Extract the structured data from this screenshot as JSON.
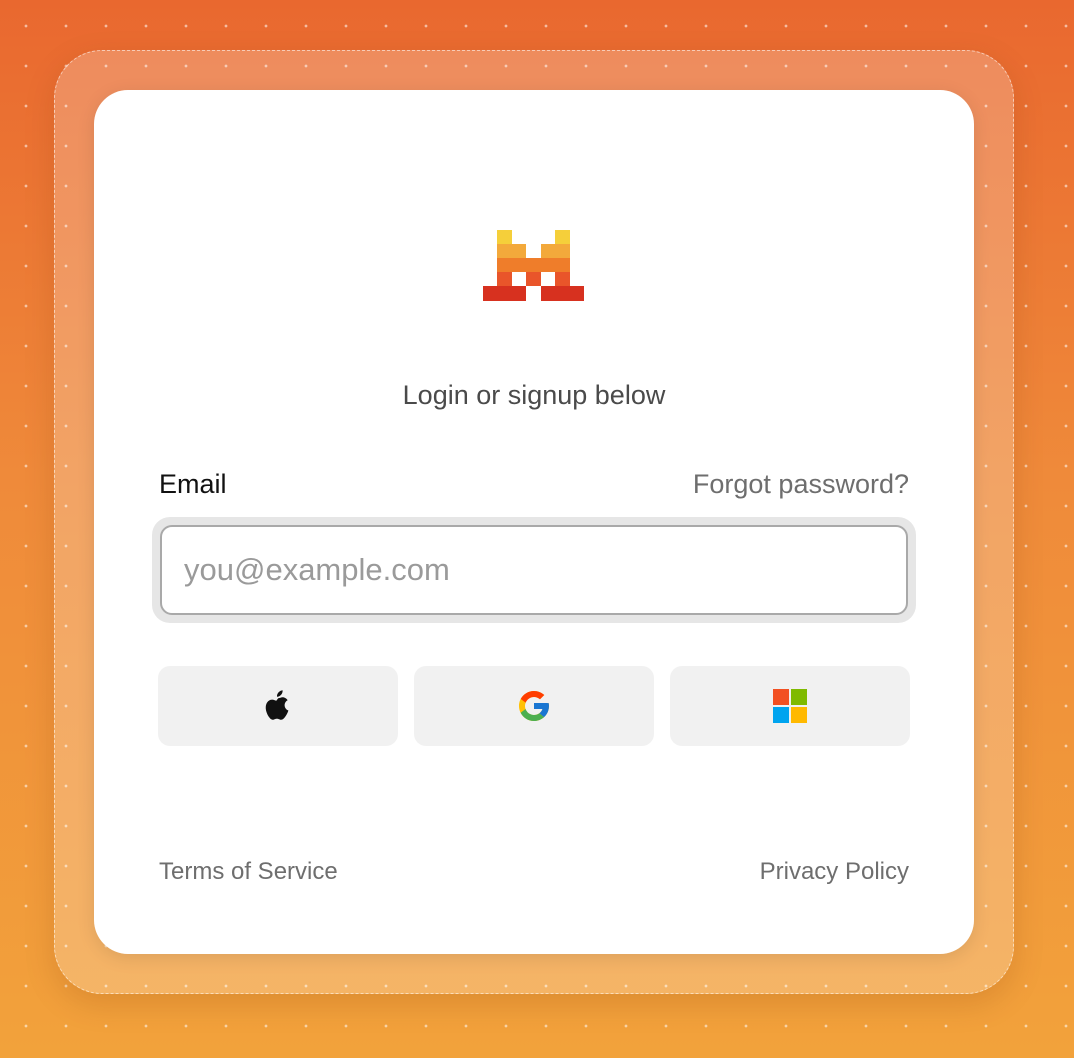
{
  "brand": {
    "logo_icon": "pixel-m-logo-icon",
    "colors": {
      "yellow": "#f5cf3a",
      "light_orange": "#f3a93b",
      "orange": "#ef7d2a",
      "dark_orange": "#e9552a",
      "red": "#d7311f"
    }
  },
  "auth": {
    "tagline": "Login or signup below",
    "email_label": "Email",
    "forgot_password": "Forgot password?",
    "email_placeholder": "you@example.com",
    "email_value": ""
  },
  "sso": [
    {
      "provider": "apple",
      "icon": "apple-icon"
    },
    {
      "provider": "google",
      "icon": "google-icon"
    },
    {
      "provider": "microsoft",
      "icon": "microsoft-icon"
    }
  ],
  "footer": {
    "terms": "Terms of Service",
    "privacy": "Privacy Policy"
  },
  "background": {
    "gradient_top": "#e9682f",
    "gradient_bottom": "#f2a23b"
  }
}
